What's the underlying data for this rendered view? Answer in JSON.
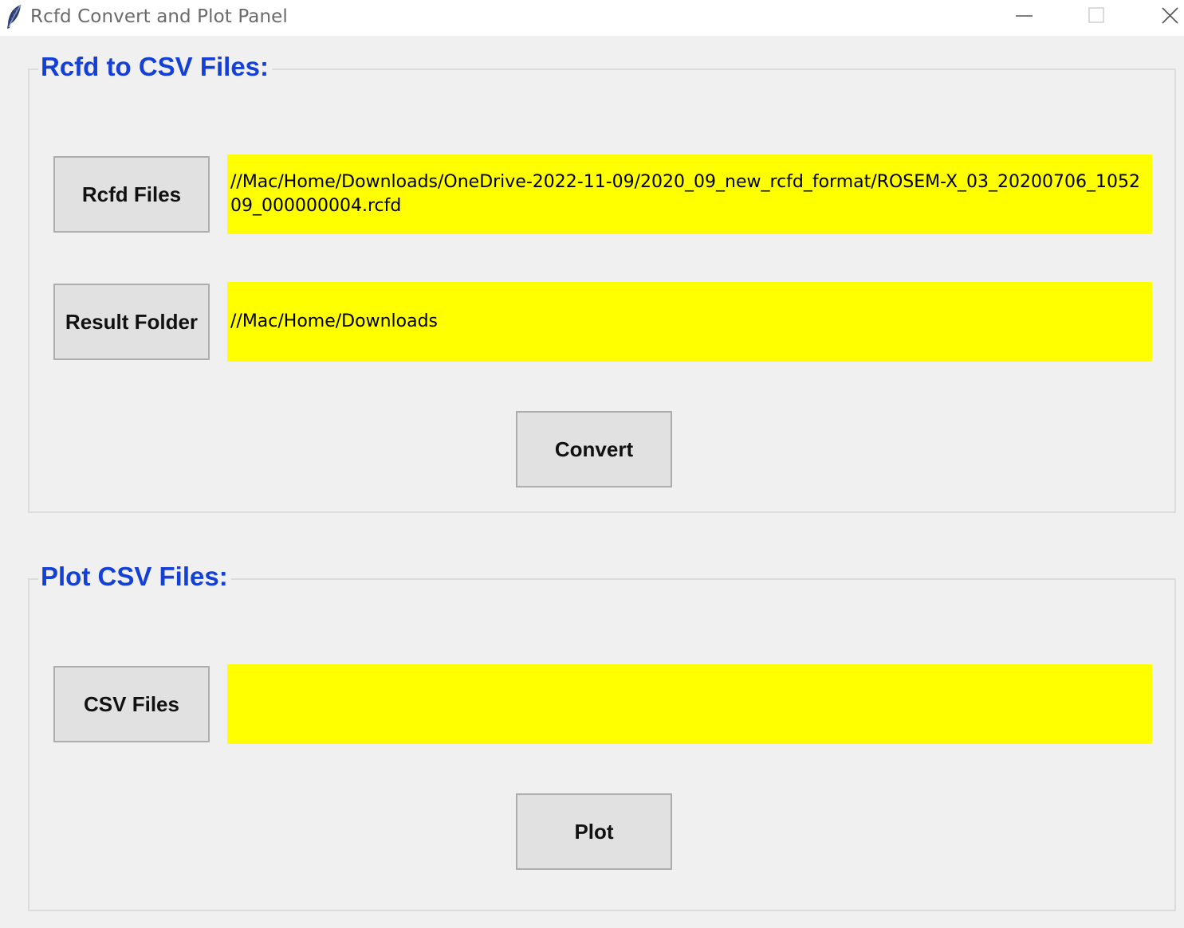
{
  "window": {
    "title": "Rcfd Convert and Plot Panel",
    "icon": "feather-icon",
    "controls": [
      "minimize-icon",
      "maximize-icon",
      "close-icon"
    ]
  },
  "convert_section": {
    "title": "Rcfd to CSV Files:",
    "rcfd_button_label": "Rcfd Files",
    "rcfd_path": "//Mac/Home/Downloads/OneDrive-2022-11-09/2020_09_new_rcfd_format/ROSEM-X_03_20200706_105209_000000004.rcfd",
    "result_button_label": "Result Folder",
    "result_path": "//Mac/Home/Downloads",
    "convert_button_label": "Convert"
  },
  "plot_section": {
    "title": "Plot CSV Files:",
    "csv_button_label": "CSV Files",
    "csv_path": "",
    "plot_button_label": "Plot"
  },
  "colors": {
    "section_title": "#1540d6",
    "field_background": "#ffff00",
    "window_background": "#f0f0f0",
    "button_background": "#e1e1e1"
  }
}
